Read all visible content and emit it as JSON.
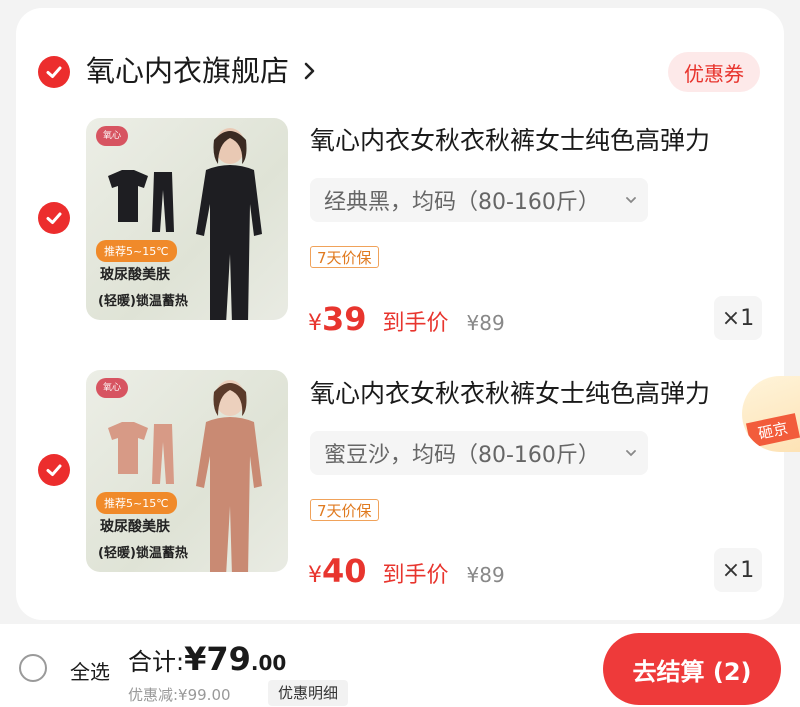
{
  "store": {
    "name": "氧心内衣旗舰店",
    "coupon_label": "优惠券"
  },
  "items": [
    {
      "title": "氧心内衣女秋衣秋裤女士纯色高弹力",
      "variant": "经典黑，均码（80-160斤）",
      "guarantee": "7天价保",
      "price_currency": "¥",
      "price": "39",
      "price_label": "到手价",
      "original_price": "¥89",
      "quantity": "×1",
      "image_badge": "推荐5~15℃",
      "image_feature_1": "玻尿酸美肤",
      "image_feature_2": "(轻暖)锁温蓄热",
      "image_logo": "氧心",
      "color": "#1e1e22"
    },
    {
      "title": "氧心内衣女秋衣秋裤女士纯色高弹力",
      "variant": "蜜豆沙，均码（80-160斤）",
      "guarantee": "7天价保",
      "price_currency": "¥",
      "price": "40",
      "price_label": "到手价",
      "original_price": "¥89",
      "quantity": "×1",
      "image_badge": "推荐5~15℃",
      "image_feature_1": "玻尿酸美肤",
      "image_feature_2": "(轻暖)锁温蓄热",
      "image_logo": "氧心",
      "color": "#c98a73"
    }
  ],
  "promo_corner": "砸京",
  "footer": {
    "select_all": "全选",
    "total_label": "合计:",
    "total_integer": "¥79",
    "total_decimal": ".00",
    "discount": "优惠减:¥99.00",
    "discount_detail": "优惠明细",
    "checkout": "去结算 (2)"
  },
  "colors": {
    "accent": "#ec2d2d",
    "price": "#e8352e",
    "guarantee": "#e07a1f"
  }
}
